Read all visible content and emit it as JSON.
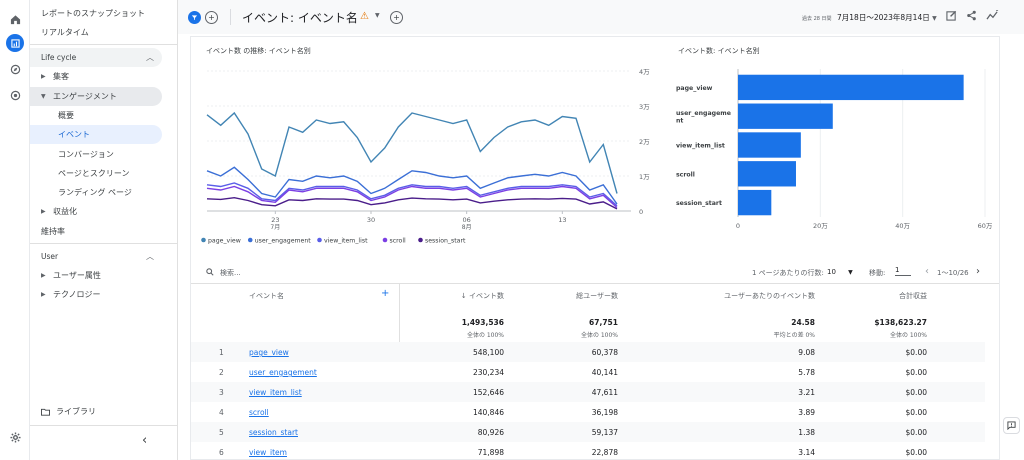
{
  "sidebar": {
    "top_items": [
      "レポートのスナップショット",
      "リアルタイム"
    ],
    "section1": "Life cycle",
    "groups1": [
      {
        "label": "集客",
        "expanded": false
      },
      {
        "label": "エンゲージメント",
        "expanded": true
      }
    ],
    "subitems": [
      "概要",
      "イベント",
      "コンバージョン",
      "ページとスクリーン",
      "ランディング ページ"
    ],
    "groups1b": [
      {
        "label": "収益化",
        "expanded": false
      }
    ],
    "retention": "維持率",
    "section2": "User",
    "groups2": [
      {
        "label": "ユーザー属性"
      },
      {
        "label": "テクノロジー"
      }
    ],
    "library": "ライブラリ",
    "collapse": "‹"
  },
  "header": {
    "title": "イベント: イベント名",
    "date_prefix": "過去 28 日間",
    "date_range": "7月18日〜2023年8月14日"
  },
  "line_chart": {
    "title": "イベント数 の推移: イベント名別",
    "legend": [
      "page_view",
      "user_engagement",
      "view_item_list",
      "scroll",
      "session_start"
    ]
  },
  "bar_chart": {
    "title": "イベント数: イベント名別"
  },
  "chart_data": [
    {
      "type": "line",
      "title": "イベント数 の推移: イベント名別",
      "x_ticks": [
        "23",
        "30",
        "06",
        "13"
      ],
      "x_tick_sub": [
        "7月",
        "",
        "8月",
        ""
      ],
      "y_ticks": [
        "0",
        "1万",
        "2万",
        "3万",
        "4万"
      ],
      "ylim": [
        0,
        40000
      ],
      "grid": true,
      "legend_position": "bottom",
      "colors": [
        "#4285b4",
        "#3b6fd6",
        "#5a5ee8",
        "#7b3fe4",
        "#4a1d8a"
      ],
      "series": [
        {
          "name": "page_view",
          "values": [
            27500,
            24500,
            28000,
            22000,
            12000,
            10000,
            24000,
            22500,
            26000,
            25000,
            25500,
            21000,
            14000,
            18000,
            24000,
            28000,
            27000,
            26000,
            25000,
            26000,
            17000,
            21000,
            24000,
            25500,
            26000,
            24500,
            27000,
            26500,
            14000,
            19000,
            5000
          ]
        },
        {
          "name": "user_engagement",
          "values": [
            11500,
            10000,
            12500,
            9000,
            5000,
            4000,
            9000,
            8500,
            10000,
            9500,
            10000,
            8500,
            5000,
            6500,
            9000,
            11500,
            11000,
            10000,
            9500,
            10000,
            6500,
            8000,
            9500,
            10000,
            10500,
            10000,
            11000,
            10000,
            6000,
            7500,
            2000
          ]
        },
        {
          "name": "view_item_list",
          "values": [
            7500,
            7000,
            8000,
            6500,
            3500,
            3000,
            6500,
            6000,
            7000,
            7000,
            7000,
            6000,
            3500,
            4500,
            6500,
            7500,
            7000,
            7000,
            6500,
            7000,
            4500,
            5500,
            6500,
            7000,
            7000,
            7000,
            7500,
            7000,
            4000,
            5000,
            1500
          ]
        },
        {
          "name": "scroll",
          "values": [
            6500,
            6000,
            7000,
            5500,
            3000,
            2500,
            6000,
            5500,
            6500,
            6500,
            6500,
            5500,
            3000,
            4000,
            6000,
            7000,
            6500,
            6500,
            6000,
            6500,
            4000,
            5000,
            6000,
            6500,
            6500,
            6500,
            7000,
            6500,
            3500,
            4500,
            1000
          ]
        },
        {
          "name": "session_start",
          "values": [
            3500,
            3300,
            3800,
            3000,
            1800,
            1500,
            3200,
            3000,
            3500,
            3400,
            3400,
            3000,
            1800,
            2300,
            3200,
            3700,
            3500,
            3400,
            3200,
            3400,
            2300,
            2800,
            3200,
            3400,
            3500,
            3400,
            3600,
            3400,
            2000,
            2600,
            600
          ]
        }
      ]
    },
    {
      "type": "bar",
      "orientation": "horizontal",
      "title": "イベント数: イベント名別",
      "categories": [
        "page_view",
        "user_engagement",
        "view_item_list",
        "scroll",
        "session_start"
      ],
      "category_labels": [
        [
          "page_view"
        ],
        [
          "user_engageme",
          "nt"
        ],
        [
          "view_item_list"
        ],
        [
          "scroll"
        ],
        [
          "session_start"
        ]
      ],
      "values": [
        548100,
        230234,
        152646,
        140846,
        80926
      ],
      "x_ticks": [
        "0",
        "20万",
        "40万",
        "60万"
      ],
      "xlim": [
        0,
        600000
      ],
      "color": "#1a73e8",
      "grid": true
    }
  ],
  "table": {
    "search_placeholder": "検索...",
    "rows_per_page_label": "1 ページあたりの行数:",
    "rows_per_page": "10",
    "goto_label": "移動:",
    "goto_value": "1",
    "pagination": "1〜10/26",
    "columns": [
      "イベント名",
      "↓ イベント数",
      "総ユーザー数",
      "ユーザーあたりのイベント数",
      "合計収益"
    ],
    "totals": [
      "1,493,536",
      "67,751",
      "24.58",
      "$138,623.27"
    ],
    "totals_sub": [
      "全体の 100%",
      "全体の 100%",
      "平均との差 0%",
      "全体の 100%"
    ],
    "rows": [
      {
        "idx": "1",
        "name": "page_view",
        "count": "548,100",
        "users": "60,378",
        "per_user": "9.08",
        "revenue": "$0.00"
      },
      {
        "idx": "2",
        "name": "user_engagement",
        "count": "230,234",
        "users": "40,141",
        "per_user": "5.78",
        "revenue": "$0.00"
      },
      {
        "idx": "3",
        "name": "view_item_list",
        "count": "152,646",
        "users": "47,611",
        "per_user": "3.21",
        "revenue": "$0.00"
      },
      {
        "idx": "4",
        "name": "scroll",
        "count": "140,846",
        "users": "36,198",
        "per_user": "3.89",
        "revenue": "$0.00"
      },
      {
        "idx": "5",
        "name": "session_start",
        "count": "80,926",
        "users": "59,137",
        "per_user": "1.38",
        "revenue": "$0.00"
      },
      {
        "idx": "6",
        "name": "view_item",
        "count": "71,898",
        "users": "22,878",
        "per_user": "3.14",
        "revenue": "$0.00"
      }
    ]
  },
  "icons": [
    "home-icon",
    "reports-icon",
    "explore-icon",
    "advertising-icon",
    "settings-icon",
    "folder-icon",
    "filter-icon",
    "add-icon",
    "warning-icon",
    "edit-icon",
    "share-icon",
    "insights-icon",
    "search-icon",
    "feedback-icon"
  ]
}
